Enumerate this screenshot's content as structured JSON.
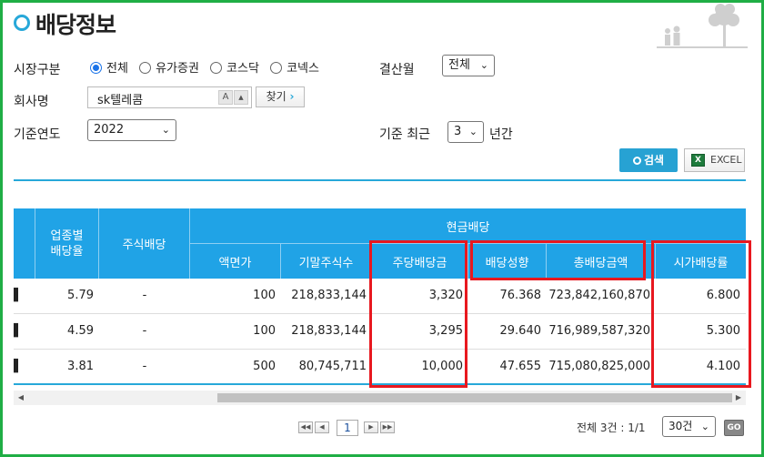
{
  "page": {
    "title": "배당정보"
  },
  "form": {
    "market_label": "시장구분",
    "market_options": [
      {
        "label": "전체",
        "selected": true
      },
      {
        "label": "유가증권",
        "selected": false
      },
      {
        "label": "코스닥",
        "selected": false
      },
      {
        "label": "코넥스",
        "selected": false
      }
    ],
    "settlement_label": "결산월",
    "settlement_value": "전체",
    "company_label": "회사명",
    "company_value": "sk텔레콤",
    "find_button": "찾기",
    "base_year_label": "기준연도",
    "base_year_value": "2022",
    "recent_label": "기준 최근",
    "recent_value": "3",
    "recent_unit": "년간",
    "search_button": "검색",
    "excel_button": "EXCEL"
  },
  "table": {
    "header_group": "현금배당",
    "headers": {
      "sector_ratio": [
        "업종별",
        "배당율"
      ],
      "stock_dividend": "주식배당",
      "par_value": "액면가",
      "shares": "기말주식수",
      "dps": "주당배당금",
      "payout": "배당성향",
      "total": "총배당금액",
      "yield": "시가배당률"
    },
    "rows": [
      {
        "sector_ratio": "5.79",
        "stock_dividend": "-",
        "par_value": "100",
        "shares": "218,833,144",
        "dps": "3,320",
        "payout": "76.368",
        "total": "723,842,160,870",
        "yield": "6.800"
      },
      {
        "sector_ratio": "4.59",
        "stock_dividend": "-",
        "par_value": "100",
        "shares": "218,833,144",
        "dps": "3,295",
        "payout": "29.640",
        "total": "716,989,587,320",
        "yield": "5.300"
      },
      {
        "sector_ratio": "3.81",
        "stock_dividend": "-",
        "par_value": "500",
        "shares": "80,745,711",
        "dps": "10,000",
        "payout": "47.655",
        "total": "715,080,825,000",
        "yield": "4.100"
      }
    ]
  },
  "pagination": {
    "current_page": "1",
    "total_text": "전체 3건 : 1/1",
    "per_page": "30건",
    "go_button": "GO"
  },
  "colors": {
    "accent": "#27a8d9",
    "header_bg": "#20a3e6",
    "highlight": "#e8181f",
    "frame": "#1fae45"
  }
}
